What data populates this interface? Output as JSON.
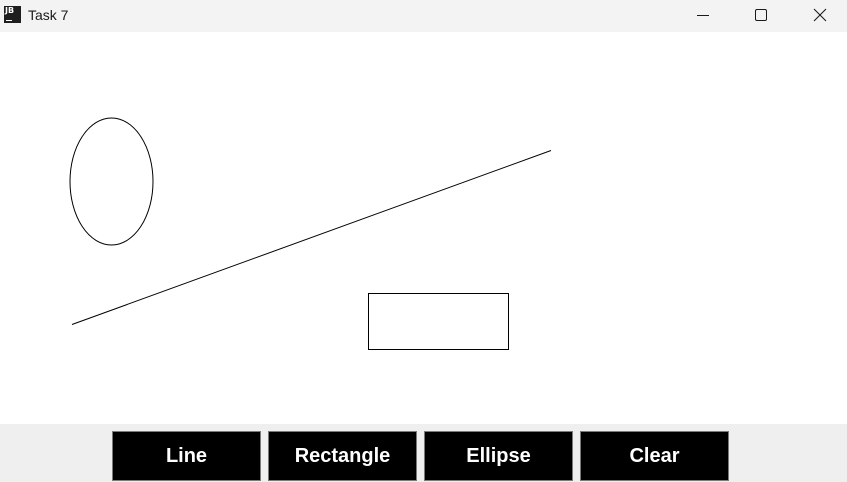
{
  "window": {
    "title": "Task 7",
    "app_icon_text": "JB"
  },
  "controls": {
    "minimize_icon": "minimize-icon",
    "maximize_icon": "maximize-icon",
    "close_icon": "close-icon"
  },
  "canvas": {
    "shapes": [
      "ellipse",
      "line",
      "rectangle"
    ]
  },
  "toolbar": {
    "line_label": "Line",
    "rectangle_label": "Rectangle",
    "ellipse_label": "Ellipse",
    "clear_label": "Clear"
  },
  "colors": {
    "button_bg": "#000000",
    "button_text": "#ffffff",
    "toolbar_bg": "#efefef",
    "titlebar_bg": "#f3f3f3",
    "stroke": "#000000"
  }
}
